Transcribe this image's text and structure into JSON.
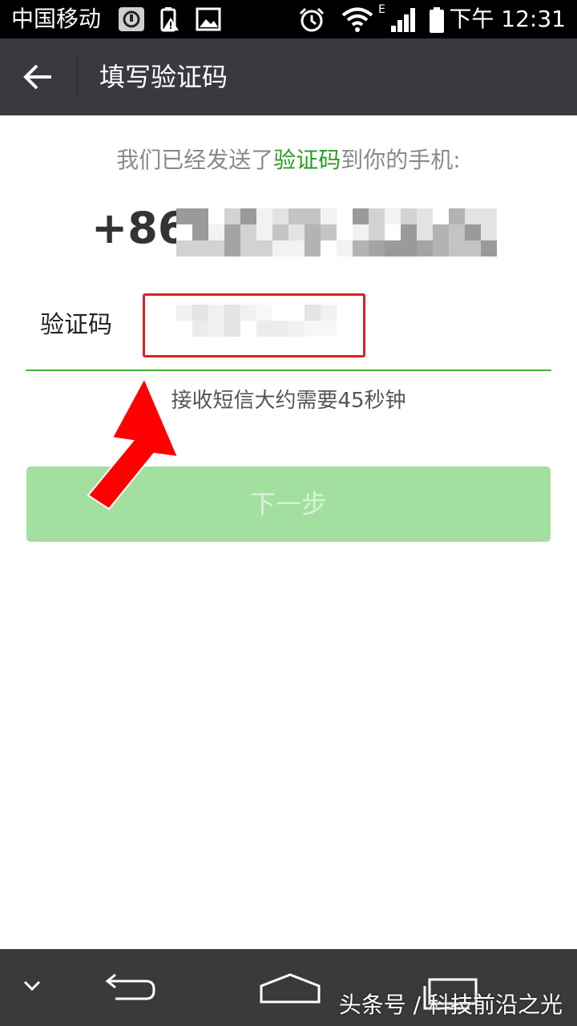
{
  "status_bar": {
    "carrier": "中国移动",
    "time": "下午 12:31",
    "network_type": "E",
    "icons": [
      "key-icon",
      "battery-alert-icon",
      "image-icon",
      "alarm-icon",
      "wifi-icon",
      "signal-icon",
      "battery-icon"
    ]
  },
  "header": {
    "title": "填写验证码",
    "back_icon": "back-arrow-icon"
  },
  "main": {
    "sent_prefix": "我们已经发送了",
    "sent_highlight": "验证码",
    "sent_suffix": "到你的手机:",
    "phone_prefix": "+86",
    "code_label": "验证码",
    "code_value": "",
    "hint": "接收短信大约需要45秒钟",
    "next_button": "下一步"
  },
  "nav_bar": {
    "icons": [
      "chevron-down-icon",
      "back-icon",
      "home-icon",
      "recents-icon"
    ]
  },
  "watermark": "头条号 / 科技前沿之光",
  "colors": {
    "status_bar_bg": "#000000",
    "title_bar_bg": "#393a3f",
    "accent_green": "#2a9a2a",
    "underline_green": "#45b035",
    "button_disabled_bg": "#a3e0a0",
    "highlight_border": "#e02020",
    "nav_bar_bg": "#3a3a3a"
  }
}
